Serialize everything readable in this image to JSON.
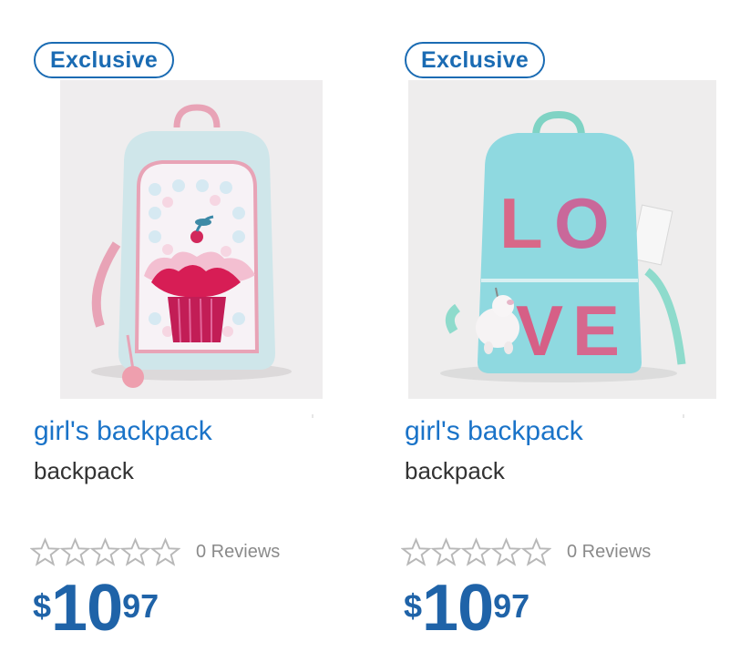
{
  "products": [
    {
      "badge": "Exclusive",
      "title": "girl's backpack",
      "subtitle": "backpack",
      "rating_stars": 0,
      "reviews": "0 Reviews",
      "price_currency": "$",
      "price_dollars": "10",
      "price_cents": "97"
    },
    {
      "badge": "Exclusive",
      "title": "girl's backpack",
      "subtitle": "backpack",
      "rating_stars": 0,
      "reviews": "0 Reviews",
      "price_currency": "$",
      "price_dollars": "10",
      "price_cents": "97"
    }
  ],
  "colors": {
    "badge": "#1a6bb3",
    "title": "#1a73c8",
    "price": "#1f63a8",
    "star_outline": "#b8b8b8"
  }
}
